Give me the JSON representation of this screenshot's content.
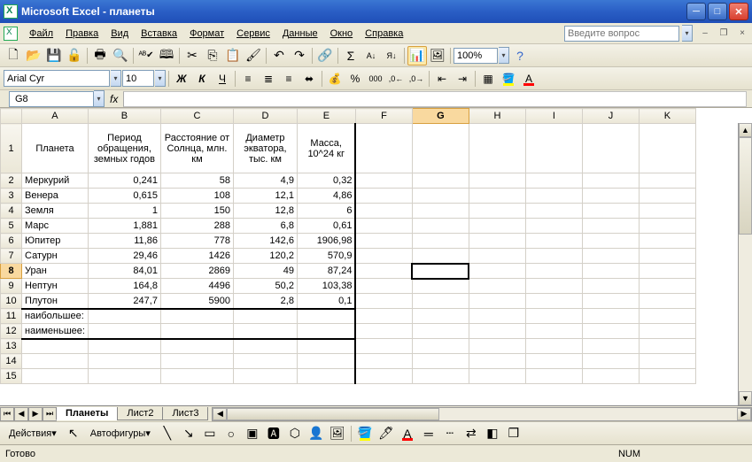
{
  "title": "Microsoft Excel - планеты",
  "menu": [
    "Файл",
    "Правка",
    "Вид",
    "Вставка",
    "Формат",
    "Сервис",
    "Данные",
    "Окно",
    "Справка"
  ],
  "help_placeholder": "Введите вопрос",
  "zoom": "100%",
  "font_name": "Arial Cyr",
  "font_size": "10",
  "name_box": "G8",
  "fx_label": "fx",
  "formula": "",
  "columns": [
    "A",
    "B",
    "C",
    "D",
    "E",
    "F",
    "G",
    "H",
    "I",
    "J",
    "K"
  ],
  "active_col": "G",
  "active_row": 8,
  "headers": {
    "A": "Планета",
    "B": "Период обращения, земных годов",
    "C": "Расстояние от Солнца, млн. км",
    "D": "Диаметр экватора, тыс. км",
    "E": "Масса, 10^24 кг"
  },
  "rows": [
    {
      "n": 2,
      "A": "Меркурий",
      "B": "0,241",
      "C": "58",
      "D": "4,9",
      "E": "0,32"
    },
    {
      "n": 3,
      "A": "Венера",
      "B": "0,615",
      "C": "108",
      "D": "12,1",
      "E": "4,86"
    },
    {
      "n": 4,
      "A": "Земля",
      "B": "1",
      "C": "150",
      "D": "12,8",
      "E": "6"
    },
    {
      "n": 5,
      "A": "Марс",
      "B": "1,881",
      "C": "288",
      "D": "6,8",
      "E": "0,61"
    },
    {
      "n": 6,
      "A": "Юпитер",
      "B": "11,86",
      "C": "778",
      "D": "142,6",
      "E": "1906,98"
    },
    {
      "n": 7,
      "A": "Сатурн",
      "B": "29,46",
      "C": "1426",
      "D": "120,2",
      "E": "570,9"
    },
    {
      "n": 8,
      "A": "Уран",
      "B": "84,01",
      "C": "2869",
      "D": "49",
      "E": "87,24"
    },
    {
      "n": 9,
      "A": "Нептун",
      "B": "164,8",
      "C": "4496",
      "D": "50,2",
      "E": "103,38"
    },
    {
      "n": 10,
      "A": "Плутон",
      "B": "247,7",
      "C": "5900",
      "D": "2,8",
      "E": "0,1"
    }
  ],
  "summary": [
    {
      "n": 11,
      "A": "наибольшее:"
    },
    {
      "n": 12,
      "A": "наименьшее:"
    }
  ],
  "empty_rows": [
    13,
    14,
    15
  ],
  "tabs": [
    "Планеты",
    "Лист2",
    "Лист3"
  ],
  "active_tab": 0,
  "draw_label": "Действия",
  "autoshapes": "Автофигуры",
  "status": "Готово",
  "num_lock": "NUM"
}
